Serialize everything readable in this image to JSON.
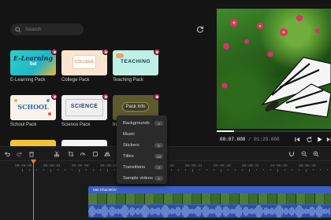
{
  "library": {
    "search_placeholder": "Search",
    "packs": [
      {
        "label": "E-Learning Pack",
        "thumb_line1": "E-Learning",
        "thumb_line2": "Set"
      },
      {
        "label": "College Pack",
        "thumb_text": "COLLEGE"
      },
      {
        "label": "Teaching Pack",
        "thumb_text": "TEACHING"
      },
      {
        "label": "School Pack",
        "thumb_text": "SCHOOL"
      },
      {
        "label": "Science Pack",
        "thumb_text": "SCIENCE"
      },
      {
        "label": "In"
      }
    ],
    "pack_info_button": "Pack Info",
    "pack_info_menu": [
      {
        "label": "Backgrounds",
        "count": "3"
      },
      {
        "label": "Music",
        "count": ""
      },
      {
        "label": "Stickers",
        "count": "5"
      },
      {
        "label": "Titles",
        "count": "10"
      },
      {
        "label": "Transitions",
        "count": "3"
      },
      {
        "label": "Sample videos",
        "count": "3"
      }
    ]
  },
  "preview": {
    "current_time": "00:07.800",
    "total_time": "01:20.000",
    "progress": 0.15
  },
  "timeline": {
    "ruler_labels": [
      "00:00:00",
      "00:00:04",
      "00:00:08",
      "00:00:12",
      "00:00:16",
      "00:00:20",
      "00:00:24",
      "00:00:28",
      "00:00:32",
      "00:00:36",
      "00:00:40"
    ],
    "clip_title": "Mei-Chat.MOV"
  },
  "colors": {
    "accent": "#f07a2a",
    "badge": "#e23d6c",
    "clip": "#3a5fc8"
  }
}
